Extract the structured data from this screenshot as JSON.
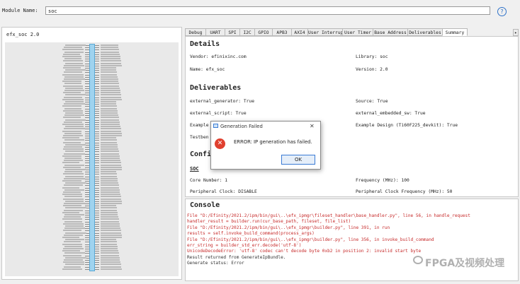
{
  "top": {
    "module_name_label": "Module Name:",
    "module_name_value": "soc",
    "help_icon": "help-icon"
  },
  "left": {
    "title": "efx_soc 2.0"
  },
  "tabs": [
    "Debug",
    "UART",
    "SPI",
    "I2C",
    "GPIO",
    "APB3",
    "AXI4",
    "User Interrupt",
    "User Timer",
    "Base Address",
    "Deliverables",
    "Summary"
  ],
  "tab_scroll_icon": "chevron-right-icon",
  "summary": {
    "details_heading": "Details",
    "vendor": "Vendor: efinixinc.com",
    "library": "Library: soc",
    "name": "Name: efx_soc",
    "version": "Version: 2.0",
    "deliverables_heading": "Deliverables",
    "ext_gen": "external_generator: True",
    "source": "Source: True",
    "ext_script": "external_script: True",
    "ext_embedded": "external_embedded_sw: True",
    "example_left": "Example",
    "example_design": "Example Design (Ti60F225_devkit): True",
    "testbench": "Testben",
    "config_heading": "Confi",
    "soc_heading": "SOC",
    "cores": "Core Number: 1",
    "frequency": "Frequency (MHz): 100",
    "periph_clock": "Peripheral Clock: DISABLE",
    "periph_freq": "Peripheral Clock Frequency (MHz): 50"
  },
  "console": {
    "title": "Console",
    "lines": [
      {
        "text": "File \"D:/Efinity/2021.2/ipm/bin/gui\\..\\efx_ipmgr\\fileset_handler\\base_handler.py\", line 56, in handle_request",
        "kind": "err"
      },
      {
        "text": "handler_result = builder.run(cur_base_path, fileset, file_list)",
        "kind": "err"
      },
      {
        "text": "File \"D:/Efinity/2021.2/ipm/bin/gui\\..\\efx_ipmgr\\builder.py\", line 391, in run",
        "kind": "err"
      },
      {
        "text": "results = self.invoke_build_command(process_args)",
        "kind": "err"
      },
      {
        "text": "File \"D:/Efinity/2021.2/ipm/bin/gui\\..\\efx_ipmgr\\builder.py\", line 356, in invoke_build_command",
        "kind": "err"
      },
      {
        "text": "err_string = builder_std_err.decode('utf-8')",
        "kind": "err"
      },
      {
        "text": "UnicodeDecodeError: 'utf-8' codec can't decode byte 0xb2 in position 2: invalid start byte",
        "kind": "err"
      },
      {
        "text": "Result returned from GenerateIpBundle.",
        "kind": "nrm"
      },
      {
        "text": "Generate status: Error",
        "kind": "nrm"
      }
    ]
  },
  "dialog": {
    "title": "Generation Failed",
    "close": "✕",
    "icon": "error-icon",
    "error_glyph": "✕",
    "message": "ERROR: IP generation has failed.",
    "ok_label": "OK"
  },
  "watermark": "FPGA及视频处理",
  "colors": {
    "error_text": "#c62828",
    "accent": "#3a7bd5",
    "block_fill": "#9fd3ef"
  }
}
